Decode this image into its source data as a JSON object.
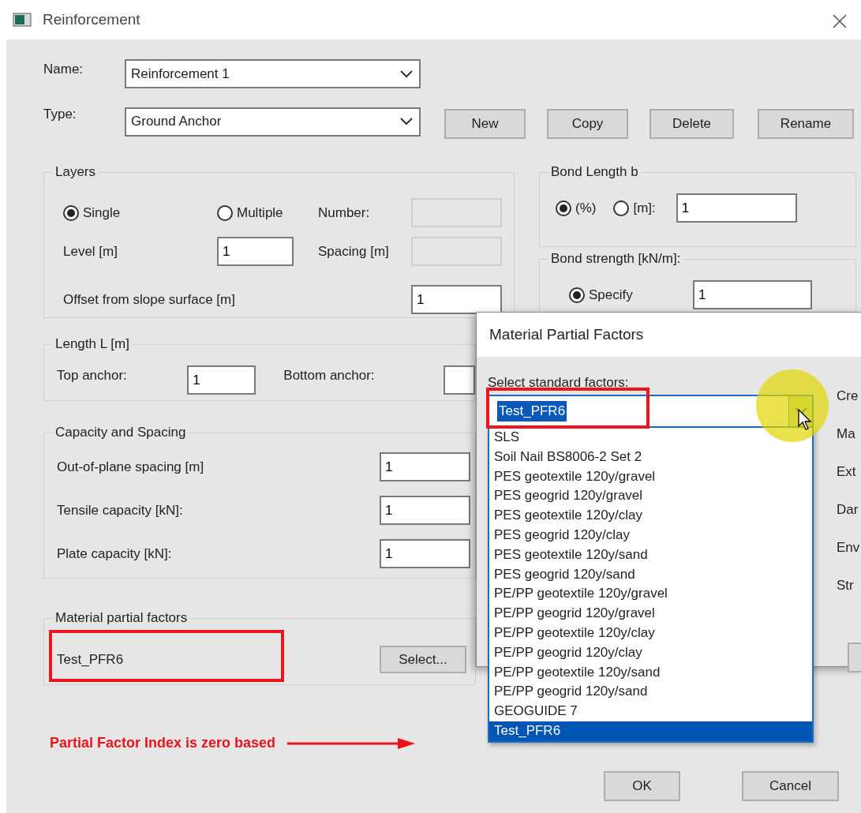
{
  "window": {
    "title": "Reinforcement"
  },
  "name": {
    "label": "Name:",
    "value": "Reinforcement 1"
  },
  "type": {
    "label": "Type:",
    "value": "Ground Anchor"
  },
  "buttons": [
    "New",
    "Copy",
    "Delete",
    "Rename"
  ],
  "layers": {
    "title": "Layers",
    "options": [
      {
        "label": "Single",
        "selected": true
      },
      {
        "label": "Multiple",
        "selected": false
      }
    ],
    "number": {
      "label": "Number:",
      "disabled": true
    },
    "level": {
      "label": "Level [m]",
      "value": "1"
    },
    "spacing": {
      "label": "Spacing [m]",
      "disabled": true
    },
    "offset": {
      "label": "Offset from slope surface [m]",
      "value": "1"
    }
  },
  "bond_length": {
    "title": "Bond Length b",
    "options": [
      {
        "label": "(%)",
        "selected": true
      },
      {
        "label": "[m]:",
        "selected": false
      }
    ],
    "value": "1"
  },
  "bond_strength": {
    "title": "Bond strength [kN/m]:",
    "options": [
      {
        "label": "Specify",
        "selected": true
      }
    ],
    "value": "1"
  },
  "length": {
    "title": "Length L [m]",
    "top": {
      "label": "Top anchor:",
      "value": "1"
    },
    "bottom": {
      "label": "Bottom anchor:"
    }
  },
  "capacity": {
    "title": "Capacity and Spacing",
    "fields": [
      {
        "label": "Out-of-plane spacing [m]",
        "value": "1"
      },
      {
        "label": "Tensile capacity [kN]:",
        "value": "1"
      },
      {
        "label": "Plate capacity [kN]:",
        "value": "1"
      }
    ]
  },
  "material": {
    "title": "Material partial factors",
    "value": "Test_PFR6",
    "button": "Select..."
  },
  "annotation": {
    "text": "Partial Factor Index is zero based"
  },
  "dialog_buttons": [
    "OK",
    "Cancel"
  ],
  "factors_dialog": {
    "title": "Material Partial Factors",
    "select_label": "Select standard factors:",
    "value": "Test_PFR6",
    "side_labels": [
      "Cre",
      "Ma",
      "Ext",
      "Dar",
      "Env",
      "Str"
    ],
    "options": [
      {
        "label": "SLS",
        "selected": false
      },
      {
        "label": "Soil Nail BS8006-2 Set 2",
        "selected": false
      },
      {
        "label": "PES geotextile 120y/gravel",
        "selected": false
      },
      {
        "label": "PES geogrid 120y/gravel",
        "selected": false
      },
      {
        "label": "PES geotextile 120y/clay",
        "selected": false
      },
      {
        "label": "PES geogrid 120y/clay",
        "selected": false
      },
      {
        "label": "PES geotextile 120y/sand",
        "selected": false
      },
      {
        "label": "PES geogrid 120y/sand",
        "selected": false
      },
      {
        "label": "PE/PP geotextile 120y/gravel",
        "selected": false
      },
      {
        "label": "PE/PP geogrid 120y/gravel",
        "selected": false
      },
      {
        "label": "PE/PP geotextile 120y/clay",
        "selected": false
      },
      {
        "label": "PE/PP geogrid 120y/clay",
        "selected": false
      },
      {
        "label": "PE/PP geotextile 120y/sand",
        "selected": false
      },
      {
        "label": "PE/PP geogrid 120y/sand",
        "selected": false
      },
      {
        "label": "GEOGUIDE 7",
        "selected": false
      },
      {
        "label": "Test_PFR6",
        "selected": true
      }
    ]
  }
}
